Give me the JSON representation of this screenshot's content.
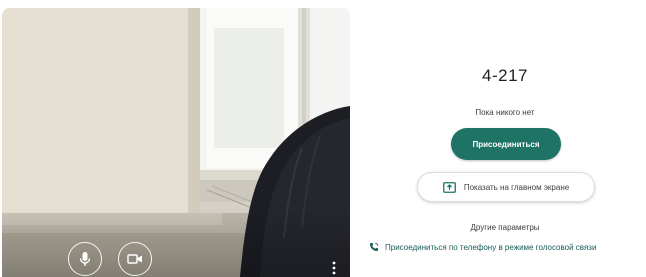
{
  "preview": {
    "controls": {
      "mic_icon": "microphone-icon",
      "camera_icon": "video-camera-icon",
      "more_icon": "more-vert-icon"
    }
  },
  "meeting": {
    "room_code": "4-217",
    "status": "Пока никого нет",
    "join_label": "Присоединиться",
    "present_label": "Показать на главном экране",
    "present_icon": "present-screen-icon",
    "other_options": "Другие параметры",
    "phone_join_label": "Присоединиться по телефону в режиме голосовой связи",
    "phone_icon": "phone-icon"
  },
  "colors": {
    "accent": "#1e7365",
    "link": "#1a5c57",
    "text": "#3c4043"
  }
}
